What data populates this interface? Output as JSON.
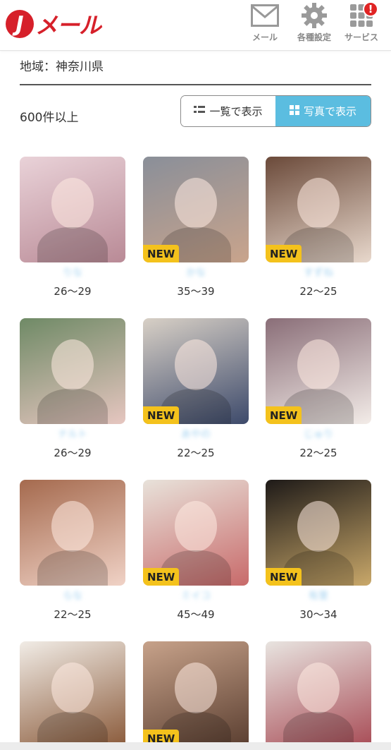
{
  "header": {
    "logo_j": "J",
    "logo_text": "メール",
    "nav": [
      {
        "label": "メール",
        "icon": "mail-icon"
      },
      {
        "label": "各種設定",
        "icon": "gear-icon"
      },
      {
        "label": "サービス",
        "icon": "grid-icon",
        "badge": "!"
      }
    ]
  },
  "filter": {
    "region": "地域：神奈川県",
    "count": "600件以上"
  },
  "view_toggle": {
    "list_label": "一覧で表示",
    "photo_label": "写真で表示",
    "active": "photo"
  },
  "new_label": "NEW",
  "profiles": [
    {
      "name": "りな",
      "age": "26〜29",
      "new": false,
      "colors": [
        "#e9d2d8",
        "#b98a96"
      ]
    },
    {
      "name": "かな",
      "age": "35〜39",
      "new": true,
      "colors": [
        "#8a8f99",
        "#c9a48c"
      ]
    },
    {
      "name": "すずね",
      "age": "22〜25",
      "new": true,
      "colors": [
        "#6b4a3a",
        "#e8d8cc"
      ]
    },
    {
      "name": "ナルト",
      "age": "26〜29",
      "new": false,
      "colors": [
        "#6f8a66",
        "#e6c6c0"
      ]
    },
    {
      "name": "あやの",
      "age": "22〜25",
      "new": true,
      "colors": [
        "#d8d0c6",
        "#3d4a6b"
      ]
    },
    {
      "name": "じゅり",
      "age": "22〜25",
      "new": true,
      "colors": [
        "#8a6e78",
        "#f3ece8"
      ]
    },
    {
      "name": "らな",
      "age": "22〜25",
      "new": false,
      "colors": [
        "#a56a4e",
        "#f0d2c6"
      ]
    },
    {
      "name": "ミイコ",
      "age": "45〜49",
      "new": true,
      "colors": [
        "#e8e2da",
        "#c86a6a"
      ]
    },
    {
      "name": "有里",
      "age": "30〜34",
      "new": true,
      "colors": [
        "#1e1a18",
        "#c9a86a"
      ]
    },
    {
      "name": "",
      "age": "",
      "new": false,
      "colors": [
        "#f1ece6",
        "#8a5a3a"
      ]
    },
    {
      "name": "",
      "age": "",
      "new": true,
      "colors": [
        "#c7a28a",
        "#5a3e30"
      ]
    },
    {
      "name": "",
      "age": "",
      "new": false,
      "colors": [
        "#e8e4e0",
        "#a84c56"
      ]
    }
  ]
}
